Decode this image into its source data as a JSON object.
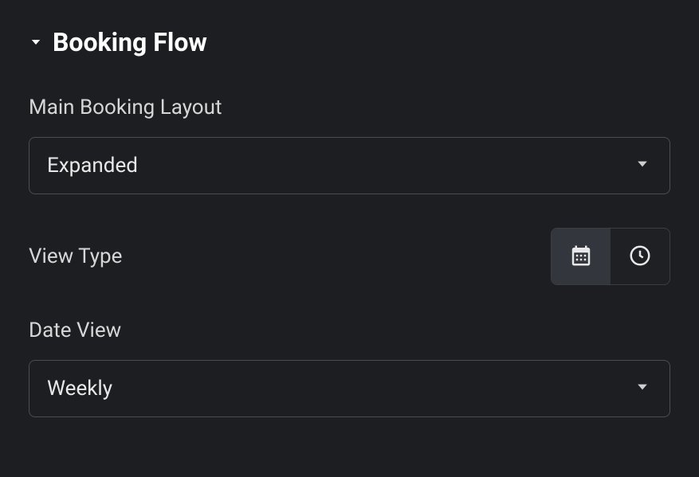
{
  "section": {
    "title": "Booking Flow"
  },
  "fields": {
    "main_layout": {
      "label": "Main Booking Layout",
      "value": "Expanded"
    },
    "view_type": {
      "label": "View Type",
      "selected": "calendar"
    },
    "date_view": {
      "label": "Date View",
      "value": "Weekly"
    }
  }
}
